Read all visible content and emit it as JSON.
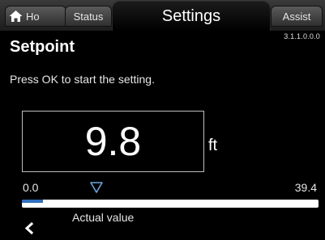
{
  "tabs": {
    "home": "Ho",
    "status": "Status",
    "settings": "Settings",
    "assist": "Assist"
  },
  "version": "3.1.1.0.0.0",
  "title": "Setpoint",
  "instruction": "Press OK to start the setting.",
  "setpoint": {
    "value": "9.8",
    "unit": "ft",
    "range_min": "0.0",
    "range_max": "39.4",
    "actual_label": "Actual value",
    "actual_fraction": 0.07,
    "marker_fraction": 0.25
  },
  "icons": {
    "home": "home-icon",
    "marker": "triangle-down-icon",
    "back": "chevron-left-icon"
  },
  "colors": {
    "accent": "#2f6fbe",
    "marker": "#6ea3d8"
  }
}
